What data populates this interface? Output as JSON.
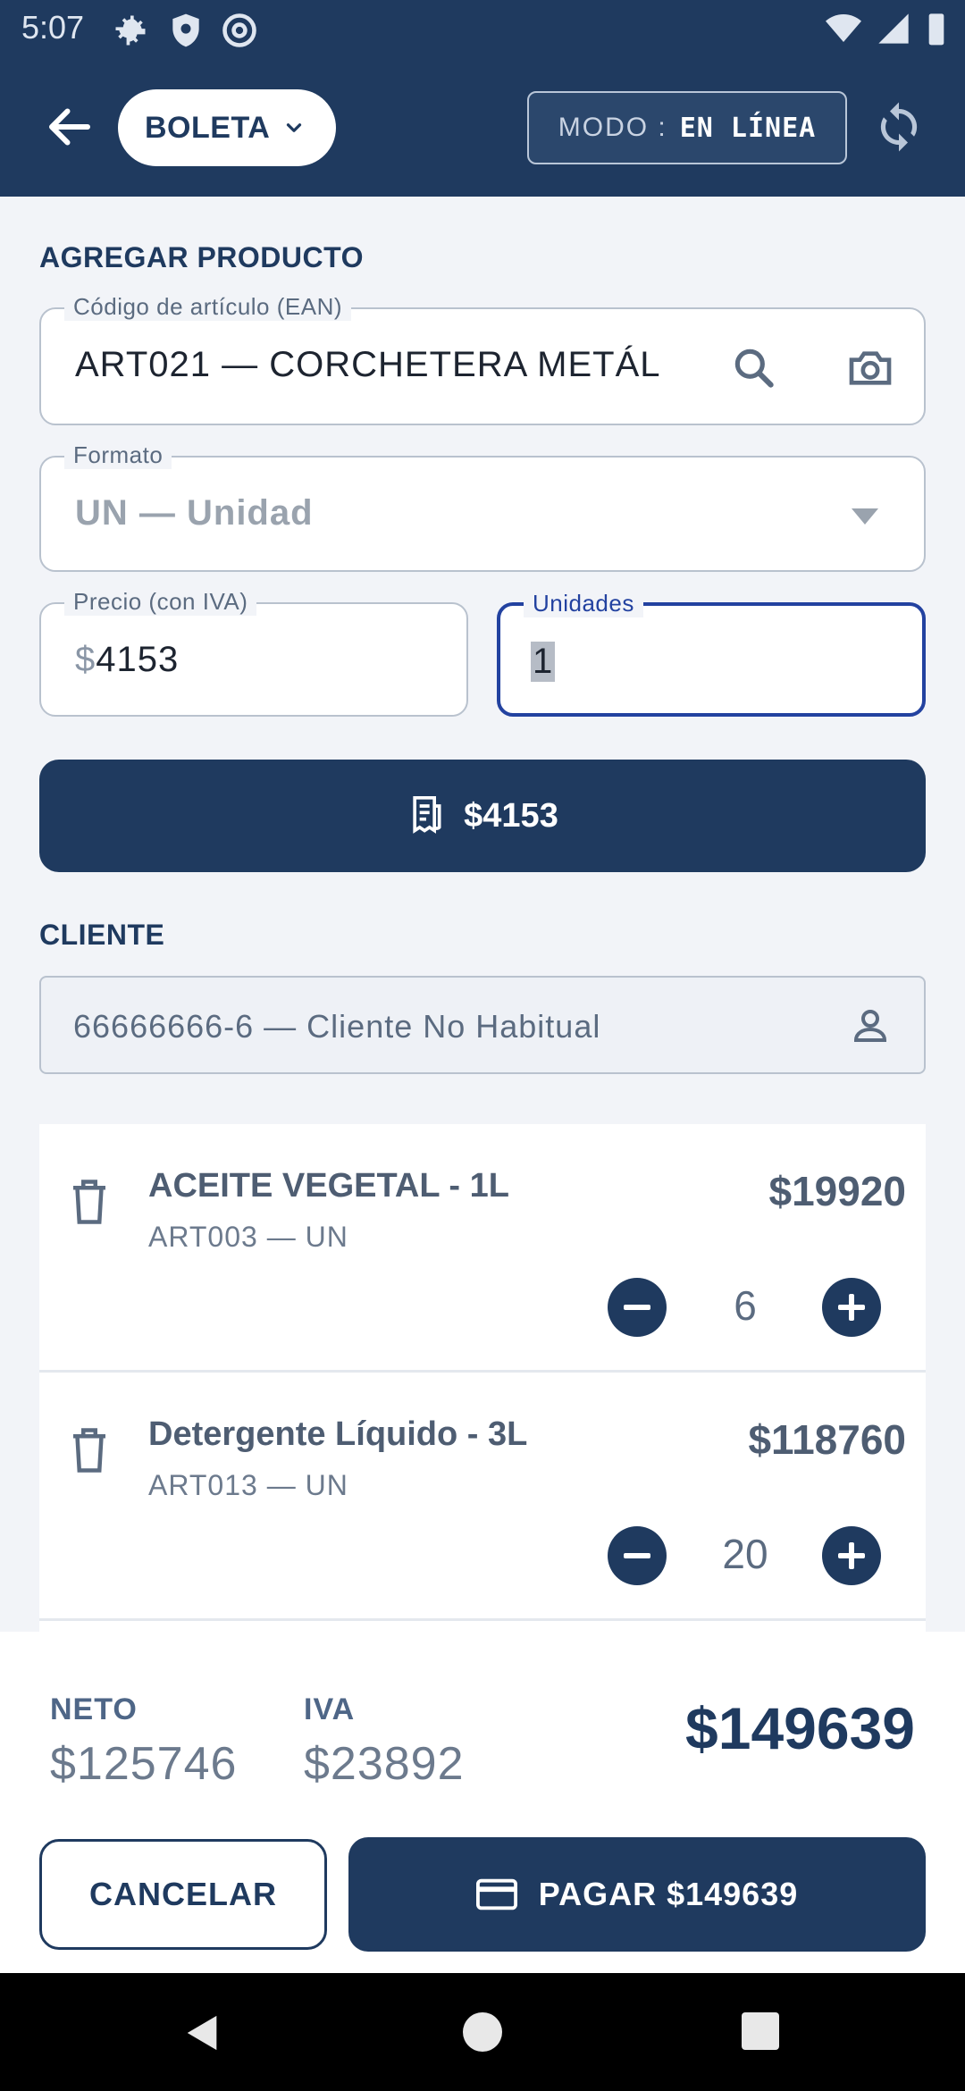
{
  "status_bar": {
    "time": "5:07"
  },
  "app_bar": {
    "document_type": "BOLETA",
    "mode_label": "MODO :",
    "mode_value": "EN LÍNEA"
  },
  "add_product": {
    "section_title": "AGREGAR PRODUCTO",
    "ean_label": "Código de artículo (EAN)",
    "ean_value": "ART021 — CORCHETERA METÁL",
    "format_label": "Formato",
    "format_value": "UN — Unidad",
    "price_label": "Precio (con IVA)",
    "price_prefix": "$",
    "price_value": "4153",
    "units_label": "Unidades",
    "units_value": "1",
    "add_button_label": "$4153"
  },
  "client": {
    "section_title": "CLIENTE",
    "value": "66666666-6 — Cliente No Habitual"
  },
  "cart": [
    {
      "name": "ACEITE VEGETAL - 1L",
      "code": "ART003 — UN",
      "price": "$19920",
      "qty": "6"
    },
    {
      "name": "Detergente Líquido - 3L",
      "code": "ART013 — UN",
      "price": "$118760",
      "qty": "20"
    }
  ],
  "summary": {
    "neto_label": "NETO",
    "neto_value": "$125746",
    "iva_label": "IVA",
    "iva_value": "$23892",
    "total": "$149639",
    "cancel_label": "CANCELAR",
    "pay_label": "PAGAR $149639"
  },
  "colors": {
    "primary": "#1f3a5f",
    "focus": "#2342a0",
    "background": "#f2f4f8"
  }
}
